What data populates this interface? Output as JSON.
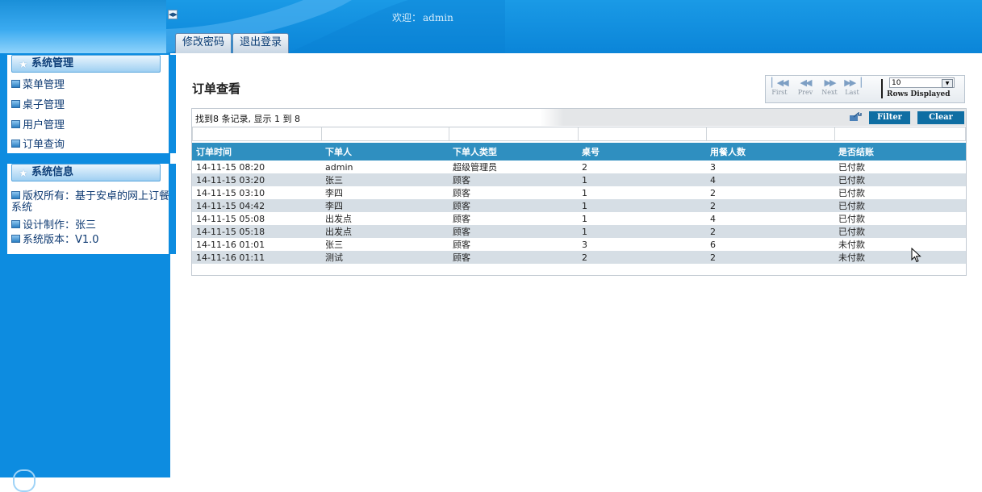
{
  "header": {
    "welcome_label": "欢迎：",
    "welcome_user": "admin",
    "buttons": {
      "change_password": "修改密码",
      "logout": "退出登录"
    }
  },
  "sidebar": {
    "panels": [
      {
        "title": "系统管理",
        "items": [
          "菜单管理",
          "桌子管理",
          "用户管理",
          "订单查询"
        ]
      },
      {
        "title": "系统信息",
        "items": [
          "版权所有：基于安卓的网上订餐系统",
          "设计制作：张三",
          "系统版本：V1.0"
        ]
      }
    ]
  },
  "main": {
    "title": "订单查看",
    "pager": {
      "first": "First",
      "prev": "Prev",
      "next": "Next",
      "last": "Last",
      "rows_value": "10",
      "rows_label": "Rows Displayed"
    },
    "toolbar": {
      "found_text": "找到8 条记录, 显示 1 到 8",
      "filter_label": "Filter",
      "clear_label": "Clear"
    },
    "table": {
      "columns": [
        "订单时间",
        "下单人",
        "下单人类型",
        "桌号",
        "用餐人数",
        "是否结账"
      ],
      "rows": [
        [
          "14-11-15 08:20",
          "admin",
          "超级管理员",
          "2",
          "3",
          "已付款"
        ],
        [
          "14-11-15 03:20",
          "张三",
          "顾客",
          "1",
          "4",
          "已付款"
        ],
        [
          "14-11-15 03:10",
          "李四",
          "顾客",
          "1",
          "2",
          "已付款"
        ],
        [
          "14-11-15 04:42",
          "李四",
          "顾客",
          "1",
          "2",
          "已付款"
        ],
        [
          "14-11-15 05:08",
          "出发点",
          "顾客",
          "1",
          "4",
          "已付款"
        ],
        [
          "14-11-15 05:18",
          "出发点",
          "顾客",
          "1",
          "2",
          "已付款"
        ],
        [
          "14-11-16 01:01",
          "张三",
          "顾客",
          "3",
          "6",
          "未付款"
        ],
        [
          "14-11-16 01:11",
          "测试",
          "顾客",
          "2",
          "2",
          "未付款"
        ]
      ]
    }
  },
  "colors": {
    "brand_blue": "#0d8ce0",
    "header_row": "#2f8fc0",
    "stripe": "#d6dee5",
    "button_blue": "#0f6ea3"
  },
  "icons": [
    "toggle-icon",
    "star-icon",
    "bullet-square-icon",
    "first-page-icon",
    "prev-page-icon",
    "next-page-icon",
    "last-page-icon",
    "dropdown-arrow-icon",
    "export-icon",
    "mouse-cursor-icon"
  ]
}
